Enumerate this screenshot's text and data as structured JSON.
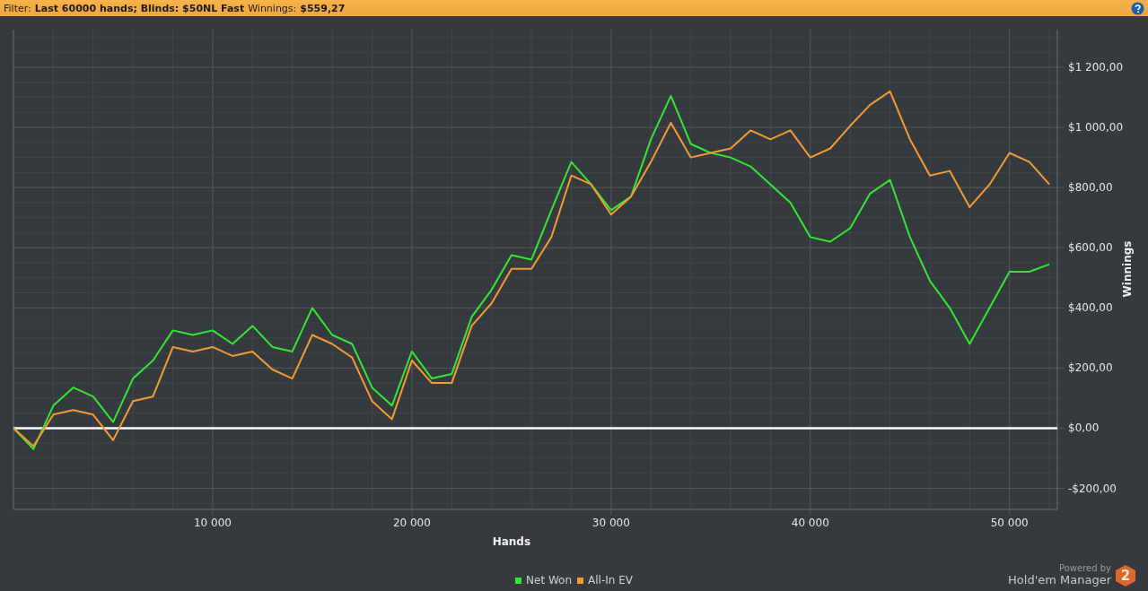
{
  "filter_bar": {
    "label": "Filter:",
    "filter": "Last 60000 hands; Blinds: $50NL Fast",
    "winnings_label": "Winnings:",
    "winnings": "$559,27"
  },
  "graph": {
    "chart_data": {
      "type": "line",
      "grid": true,
      "xlabel": "Hands",
      "ylabel": "Winnings",
      "x": [
        0,
        1000,
        2000,
        3000,
        4000,
        5000,
        6000,
        7000,
        8000,
        9000,
        10000,
        11000,
        12000,
        13000,
        14000,
        15000,
        16000,
        17000,
        18000,
        19000,
        20000,
        21000,
        22000,
        23000,
        24000,
        25000,
        26000,
        27000,
        28000,
        29000,
        30000,
        31000,
        32000,
        33000,
        34000,
        35000,
        36000,
        37000,
        38000,
        39000,
        40000,
        41000,
        42000,
        43000,
        44000,
        45000,
        46000,
        47000,
        48000,
        49000,
        50000,
        51000,
        52000
      ],
      "series": [
        {
          "name": "Net Won",
          "color": "#33e633",
          "values": [
            0,
            -70,
            75,
            135,
            105,
            20,
            165,
            225,
            325,
            310,
            325,
            280,
            340,
            270,
            255,
            400,
            310,
            280,
            135,
            75,
            255,
            165,
            180,
            370,
            460,
            575,
            560,
            725,
            885,
            810,
            725,
            770,
            960,
            1105,
            945,
            915,
            900,
            870,
            810,
            750,
            635,
            620,
            665,
            780,
            825,
            635,
            490,
            400,
            280,
            400,
            520,
            520,
            545
          ]
        },
        {
          "name": "All-In EV",
          "color": "#f39a35",
          "values": [
            0,
            -60,
            45,
            60,
            45,
            -40,
            90,
            105,
            270,
            255,
            270,
            240,
            255,
            195,
            165,
            310,
            280,
            235,
            90,
            30,
            225,
            150,
            150,
            340,
            415,
            530,
            530,
            635,
            840,
            810,
            710,
            770,
            885,
            1015,
            900,
            915,
            930,
            990,
            960,
            990,
            900,
            930,
            1005,
            1075,
            1120,
            960,
            840,
            855,
            735,
            810,
            915,
            885,
            810
          ]
        }
      ],
      "xlim": [
        0,
        52400
      ],
      "ylim": [
        -270,
        1325
      ],
      "xticks": [
        {
          "value": 10000,
          "label": "10 000"
        },
        {
          "value": 20000,
          "label": "20 000"
        },
        {
          "value": 30000,
          "label": "30 000"
        },
        {
          "value": 40000,
          "label": "40 000"
        },
        {
          "value": 50000,
          "label": "50 000"
        }
      ],
      "yticks": [
        {
          "value": -200,
          "label": "-$200,00"
        },
        {
          "value": 0,
          "label": "$0,00"
        },
        {
          "value": 200,
          "label": "$200,00"
        },
        {
          "value": 400,
          "label": "$400,00"
        },
        {
          "value": 600,
          "label": "$600,00"
        },
        {
          "value": 800,
          "label": "$800,00"
        },
        {
          "value": 1000,
          "label": "$1 000,00"
        },
        {
          "value": 1200,
          "label": "$1 200,00"
        }
      ]
    }
  },
  "branding": {
    "powered_by": "Powered by",
    "product": "Hold'em Manager",
    "logo_mark": "2"
  }
}
